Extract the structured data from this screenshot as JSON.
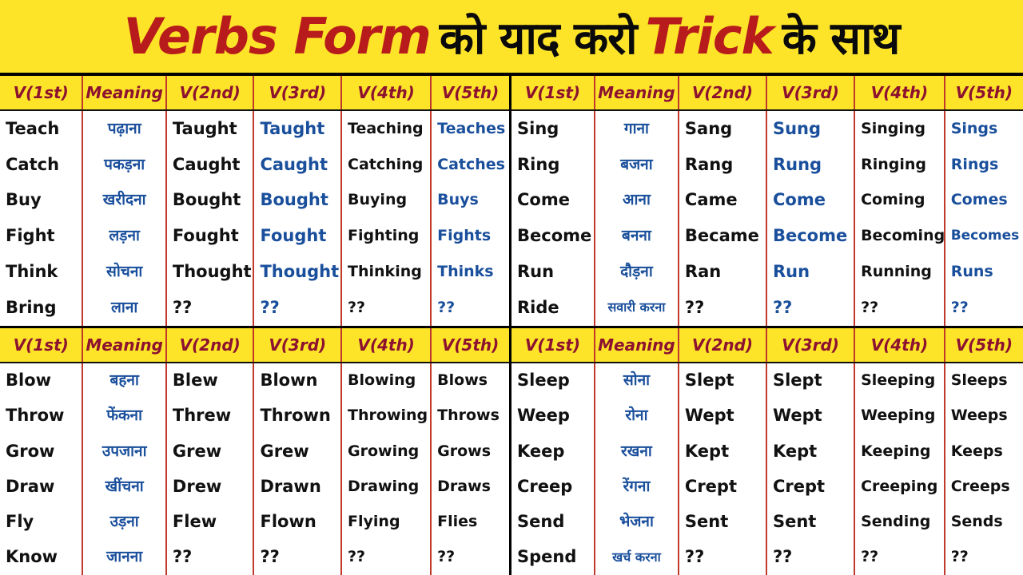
{
  "title": {
    "part1": "Verbs Form",
    "part2": "को याद करो",
    "part3": "Trick",
    "part4": "के साथ"
  },
  "colors": {
    "banner_bg": "#fde428",
    "title_red": "#b81b1b",
    "title_black": "#0a0a0a",
    "header_text": "#8c1230",
    "cell_black": "#111111",
    "cell_blue": "#1a4f9c",
    "grid_red": "#c0392b",
    "grid_black": "#000000"
  },
  "headers": [
    "V(1st)",
    "Meaning",
    "V(2nd)",
    "V(3rd)",
    "V(4th)",
    "V(5th)"
  ],
  "panels": [
    {
      "id": "top-left",
      "headers": [
        "V(1st)",
        "Meaning",
        "V(2nd)",
        "V(3rd)",
        "V(4th)",
        "V(5th)"
      ],
      "columns": [
        {
          "key": "v1",
          "style": "black",
          "values": [
            "Teach",
            "Catch",
            "Buy",
            "Fight",
            "Think",
            "Bring"
          ]
        },
        {
          "key": "meaning",
          "style": "hindi",
          "values": [
            "पढ़ाना",
            "पकड़ना",
            "खरीदना",
            "लड़ना",
            "सोचना",
            "लाना"
          ]
        },
        {
          "key": "v2",
          "style": "black",
          "values": [
            "Taught",
            "Caught",
            "Bought",
            "Fought",
            "Thought",
            "??"
          ]
        },
        {
          "key": "v3",
          "style": "blue",
          "values": [
            "Taught",
            "Caught",
            "Bought",
            "Fought",
            "Thought",
            "??"
          ]
        },
        {
          "key": "v4",
          "style": "black",
          "values": [
            "Teaching",
            "Catching",
            "Buying",
            "Fighting",
            "Thinking",
            "??"
          ]
        },
        {
          "key": "v5",
          "style": "blue",
          "values": [
            "Teaches",
            "Catches",
            "Buys",
            "Fights",
            "Thinks",
            "??"
          ]
        }
      ]
    },
    {
      "id": "top-right",
      "headers": [
        "V(1st)",
        "Meaning",
        "V(2nd)",
        "V(3rd)",
        "V(4th)",
        "V(5th)"
      ],
      "columns": [
        {
          "key": "v1",
          "style": "black",
          "values": [
            "Sing",
            "Ring",
            "Come",
            "Become",
            "Run",
            "Ride"
          ]
        },
        {
          "key": "meaning",
          "style": "hindi",
          "values": [
            "गाना",
            "बजना",
            "आना",
            "बनना",
            "दौड़ना",
            "सवारी करना"
          ]
        },
        {
          "key": "v2",
          "style": "black",
          "values": [
            "Sang",
            "Rang",
            "Came",
            "Became",
            "Ran",
            "??"
          ]
        },
        {
          "key": "v3",
          "style": "blue",
          "values": [
            "Sung",
            "Rung",
            "Come",
            "Become",
            "Run",
            "??"
          ]
        },
        {
          "key": "v4",
          "style": "black",
          "values": [
            "Singing",
            "Ringing",
            "Coming",
            "Becoming",
            "Running",
            "??"
          ]
        },
        {
          "key": "v5",
          "style": "blue",
          "values": [
            "Sings",
            "Rings",
            "Comes",
            "Becomes",
            "Runs",
            "??"
          ]
        }
      ]
    },
    {
      "id": "bottom-left",
      "headers": [
        "V(1st)",
        "Meaning",
        "V(2nd)",
        "V(3rd)",
        "V(4th)",
        "V(5th)"
      ],
      "columns": [
        {
          "key": "v1",
          "style": "black",
          "values": [
            "Blow",
            "Throw",
            "Grow",
            "Draw",
            "Fly",
            "Know"
          ]
        },
        {
          "key": "meaning",
          "style": "hindi",
          "values": [
            "बहना",
            "फेंकना",
            "उपजाना",
            "खींचना",
            "उड़ना",
            "जानना"
          ]
        },
        {
          "key": "v2",
          "style": "black",
          "values": [
            "Blew",
            "Threw",
            "Grew",
            "Drew",
            "Flew",
            "??"
          ]
        },
        {
          "key": "v3",
          "style": "black",
          "values": [
            "Blown",
            "Thrown",
            "Grew",
            "Drawn",
            "Flown",
            "??"
          ]
        },
        {
          "key": "v4",
          "style": "black",
          "values": [
            "Blowing",
            "Throwing",
            "Growing",
            "Drawing",
            "Flying",
            "??"
          ]
        },
        {
          "key": "v5",
          "style": "black",
          "values": [
            "Blows",
            "Throws",
            "Grows",
            "Draws",
            "Flies",
            "??"
          ]
        }
      ]
    },
    {
      "id": "bottom-right",
      "headers": [
        "V(1st)",
        "Meaning",
        "V(2nd)",
        "V(3rd)",
        "V(4th)",
        "V(5th)"
      ],
      "columns": [
        {
          "key": "v1",
          "style": "black",
          "values": [
            "Sleep",
            "Weep",
            "Keep",
            "Creep",
            "Send",
            "Spend"
          ]
        },
        {
          "key": "meaning",
          "style": "hindi",
          "values": [
            "सोना",
            "रोना",
            "रखना",
            "रेंगना",
            "भेजना",
            "खर्च करना"
          ]
        },
        {
          "key": "v2",
          "style": "black",
          "values": [
            "Slept",
            "Wept",
            "Kept",
            "Crept",
            "Sent",
            "??"
          ]
        },
        {
          "key": "v3",
          "style": "black",
          "values": [
            "Slept",
            "Wept",
            "Kept",
            "Crept",
            "Sent",
            "??"
          ]
        },
        {
          "key": "v4",
          "style": "black",
          "values": [
            "Sleeping",
            "Weeping",
            "Keeping",
            "Creeping",
            "Sending",
            "??"
          ]
        },
        {
          "key": "v5",
          "style": "black",
          "values": [
            "Sleeps",
            "Weeps",
            "Keeps",
            "Creeps",
            "Sends",
            "??"
          ]
        }
      ]
    }
  ]
}
